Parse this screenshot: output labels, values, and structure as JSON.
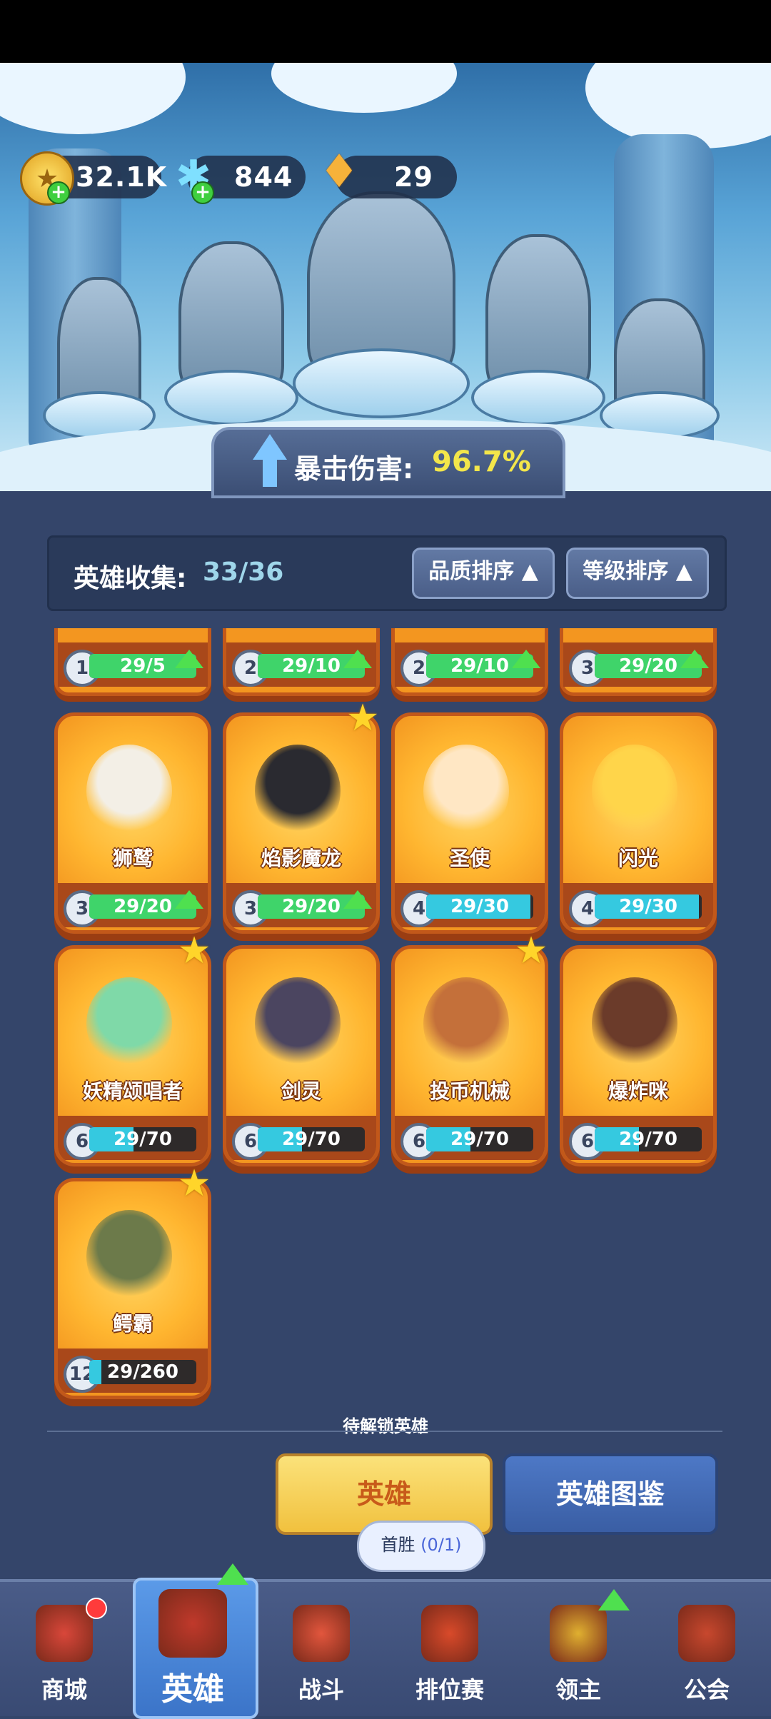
{
  "currency": {
    "gold": {
      "value": "32.1K",
      "icon": "gold-coin-icon"
    },
    "gems": {
      "value": "844",
      "icon": "ice-crystal-icon"
    },
    "shards": {
      "value": "29",
      "icon": "amber-crystal-icon"
    }
  },
  "crit": {
    "label": "暴击伤害:",
    "value": "96.7%"
  },
  "collection": {
    "label": "英雄收集:",
    "value": "33/36"
  },
  "sort": {
    "quality": "品质排序",
    "level": "等级排序"
  },
  "partial_cards": [
    {
      "level": "1",
      "progress": "29/5",
      "upgradable": true
    },
    {
      "level": "2",
      "progress": "29/10",
      "upgradable": true
    },
    {
      "level": "2",
      "progress": "29/10",
      "upgradable": true
    },
    {
      "level": "3",
      "progress": "29/20",
      "upgradable": true
    }
  ],
  "cards": [
    {
      "name": "狮鹫",
      "level": "3",
      "progress": "29/20",
      "fill": 1.0,
      "upgradable": true,
      "star": false
    },
    {
      "name": "焰影魔龙",
      "level": "3",
      "progress": "29/20",
      "fill": 1.0,
      "upgradable": true,
      "star": true
    },
    {
      "name": "圣使",
      "level": "4",
      "progress": "29/30",
      "fill": 0.97,
      "upgradable": false,
      "star": false
    },
    {
      "name": "闪光",
      "level": "4",
      "progress": "29/30",
      "fill": 0.97,
      "upgradable": false,
      "star": false
    },
    {
      "name": "妖精颂唱者",
      "level": "6",
      "progress": "29/70",
      "fill": 0.41,
      "upgradable": false,
      "star": true
    },
    {
      "name": "剑灵",
      "level": "6",
      "progress": "29/70",
      "fill": 0.41,
      "upgradable": false,
      "star": false
    },
    {
      "name": "投币机械",
      "level": "6",
      "progress": "29/70",
      "fill": 0.41,
      "upgradable": false,
      "star": true
    },
    {
      "name": "爆炸咪",
      "level": "6",
      "progress": "29/70",
      "fill": 0.41,
      "upgradable": false,
      "star": false
    },
    {
      "name": "鳄霸",
      "level": "12",
      "progress": "29/260",
      "fill": 0.11,
      "upgradable": false,
      "star": true
    }
  ],
  "pending_label": "待解锁英雄",
  "buttons": {
    "hero": "英雄",
    "codex": "英雄图鉴"
  },
  "tooltip": {
    "text": "首胜",
    "count": "(0/1)"
  },
  "nav": [
    {
      "label": "商城",
      "icon": "shop-chest-icon"
    },
    {
      "label": "英雄",
      "icon": "hero-envelope-icon"
    },
    {
      "label": "战斗",
      "icon": "battle-firecracker-icon"
    },
    {
      "label": "排位赛",
      "icon": "ranked-knot-icon"
    },
    {
      "label": "领主",
      "icon": "lord-banner-icon"
    },
    {
      "label": "公会",
      "icon": "guild-pavilion-icon"
    }
  ],
  "colors": {
    "bar_green": "#3fd46a",
    "bar_cyan": "#35c9e0",
    "crit_value": "#f3e64a",
    "accent_blue": "#3b74c8"
  }
}
